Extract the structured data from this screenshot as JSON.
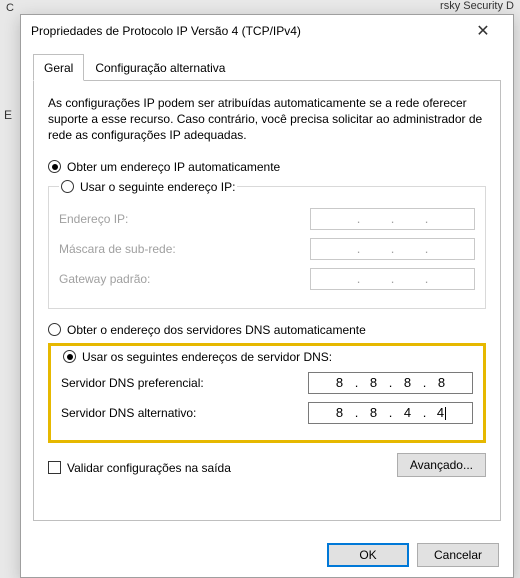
{
  "bg": {
    "left": "C",
    "right": "rsky Security D"
  },
  "sidebar_letter": "E",
  "dialog": {
    "title": "Propriedades de Protocolo IP Versão 4 (TCP/IPv4)",
    "tabs": {
      "general": "Geral",
      "alt": "Configuração alternativa"
    },
    "description": "As configurações IP podem ser atribuídas automaticamente se a rede oferecer suporte a esse recurso. Caso contrário, você precisa solicitar ao administrador de rede as configurações IP adequadas.",
    "ip_section": {
      "auto_label": "Obter um endereço IP automaticamente",
      "manual_label": "Usar o seguinte endereço IP:",
      "ip_label": "Endereço IP:",
      "mask_label": "Máscara de sub-rede:",
      "gw_label": "Gateway padrão:",
      "ip_value": [
        "",
        "",
        "",
        ""
      ],
      "mask_value": [
        "",
        "",
        "",
        ""
      ],
      "gw_value": [
        "",
        "",
        "",
        ""
      ]
    },
    "dns_section": {
      "auto_label": "Obter o endereço dos servidores DNS automaticamente",
      "manual_label": "Usar os seguintes endereços de servidor DNS:",
      "pref_label": "Servidor DNS preferencial:",
      "alt_label": "Servidor DNS alternativo:",
      "pref_value": [
        "8",
        "8",
        "8",
        "8"
      ],
      "alt_value": [
        "8",
        "8",
        "4",
        "4"
      ]
    },
    "validate_label": "Validar configurações na saída",
    "advanced_label": "Avançado...",
    "ok_label": "OK",
    "cancel_label": "Cancelar"
  }
}
